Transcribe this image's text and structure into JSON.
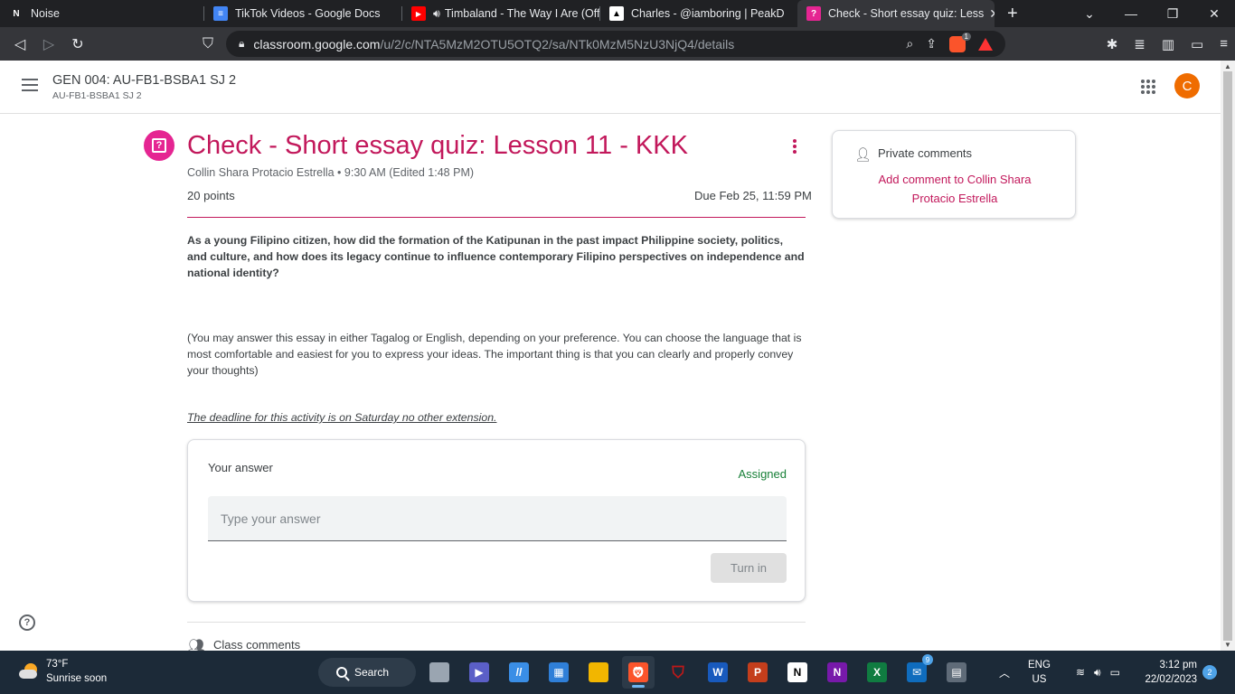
{
  "browser": {
    "tabs": [
      {
        "title": "Noise",
        "favicon": "N",
        "favicon_color": "#ffffff",
        "favicon_bg": "#202124"
      },
      {
        "title": "TikTok Videos - Google Docs",
        "favicon": "≡",
        "favicon_color": "#ffffff",
        "favicon_bg": "#4285f4"
      },
      {
        "title": "Timbaland - The Way I Are (Offi",
        "favicon": "▶",
        "favicon_color": "#ffffff",
        "favicon_bg": "#ff0000"
      },
      {
        "title": "Charles - @iamboring | PeakD",
        "favicon": "▲",
        "favicon_color": "#000000",
        "favicon_bg": "#ffffff"
      },
      {
        "title": "Check - Short essay quiz: Less",
        "favicon": "?",
        "favicon_color": "#ffffff",
        "favicon_bg": "#e52592",
        "active": true
      }
    ],
    "new_tab": "+",
    "url_domain": "classroom.google.com",
    "url_path": "/u/2/c/NTA5MzM2OTU5OTQ2/sa/NTk0MzM5NzU3NjQ4/details",
    "brave_badge": "1"
  },
  "header": {
    "class_title": "GEN 004: AU-FB1-BSBA1 SJ 2",
    "class_subtitle": "AU-FB1-BSBA1 SJ 2",
    "avatar_letter": "C"
  },
  "assignment": {
    "title": "Check - Short essay quiz: Lesson 11 - KKK",
    "meta": "Collin Shara Protacio Estrella • 9:30 AM (Edited 1:48 PM)",
    "points": "20 points",
    "due": "Due Feb 25, 11:59 PM",
    "question": "As a young Filipino citizen, how did the formation of the Katipunan in the past impact Philippine society, politics, and culture, and how does its legacy continue to influence contemporary Filipino perspectives on independence and national identity?",
    "note": "(You may answer this essay in either Tagalog or English, depending on your preference. You can choose the language that is most comfortable and easiest for you to express your ideas. The important thing is that you can clearly and properly convey your thoughts)",
    "deadline": "The deadline for this activity is on Saturday no other extension."
  },
  "answer": {
    "label": "Your answer",
    "status": "Assigned",
    "placeholder": "Type your answer",
    "turn_in": "Turn in"
  },
  "class_comments": {
    "label": "Class comments"
  },
  "private_comments": {
    "title": "Private comments",
    "add_link": "Add comment to Collin Shara Protacio Estrella"
  },
  "taskbar": {
    "temp": "73°F",
    "weather_text": "Sunrise soon",
    "search_label": "Search",
    "mail_badge": "9",
    "lang_top": "ENG",
    "lang_bottom": "US",
    "time": "3:12 pm",
    "date": "22/02/2023",
    "notification_count": "2"
  },
  "colors": {
    "accent": "#c2185b",
    "assigned_green": "#188038",
    "avatar_orange": "#ef6c00"
  }
}
